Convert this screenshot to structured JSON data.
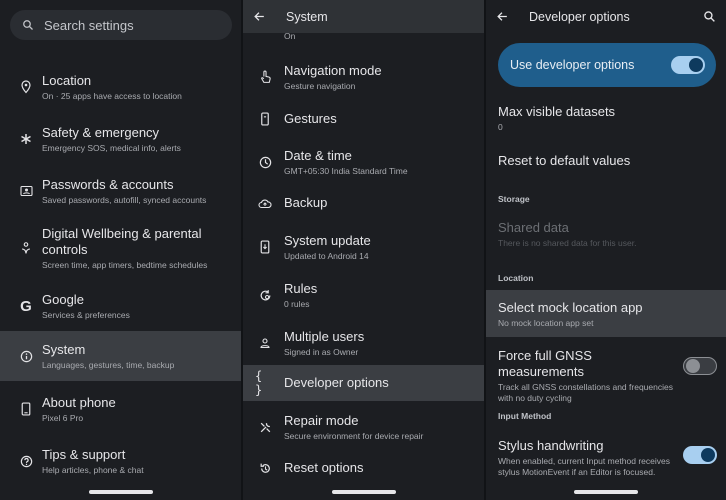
{
  "colors": {
    "background": "#1c1e22",
    "selected": "#3b3e43",
    "accent": "#1f5e8c",
    "toggle_on": "#a8cff0"
  },
  "settings": {
    "search_placeholder": "Search settings",
    "items": [
      {
        "icon": "location-pin-icon",
        "title": "Location",
        "subtitle": "On · 25 apps have access to location"
      },
      {
        "icon": "asterisk-icon",
        "title": "Safety & emergency",
        "subtitle": "Emergency SOS, medical info, alerts"
      },
      {
        "icon": "id-card-icon",
        "title": "Passwords & accounts",
        "subtitle": "Saved passwords, autofill, synced accounts"
      },
      {
        "icon": "wellbeing-icon",
        "title": "Digital Wellbeing & parental controls",
        "subtitle": "Screen time, app timers, bedtime schedules"
      },
      {
        "icon": "google-icon",
        "title": "Google",
        "subtitle": "Services & preferences"
      },
      {
        "icon": "info-icon",
        "title": "System",
        "subtitle": "Languages, gestures, time, backup"
      },
      {
        "icon": "phone-icon",
        "title": "About phone",
        "subtitle": "Pixel 6 Pro"
      },
      {
        "icon": "help-icon",
        "title": "Tips & support",
        "subtitle": "Help articles, phone & chat"
      }
    ]
  },
  "system": {
    "title": "System",
    "cut_text": "On",
    "items": [
      {
        "icon": "navigation-mode-icon",
        "title": "Navigation mode",
        "subtitle": "Gesture navigation"
      },
      {
        "icon": "gestures-icon",
        "title": "Gestures",
        "subtitle": ""
      },
      {
        "icon": "clock-icon",
        "title": "Date & time",
        "subtitle": "GMT+05:30 India Standard Time"
      },
      {
        "icon": "cloud-icon",
        "title": "Backup",
        "subtitle": ""
      },
      {
        "icon": "system-update-icon",
        "title": "System update",
        "subtitle": "Updated to Android 14"
      },
      {
        "icon": "rules-icon",
        "title": "Rules",
        "subtitle": "0 rules"
      },
      {
        "icon": "person-icon",
        "title": "Multiple users",
        "subtitle": "Signed in as Owner"
      },
      {
        "icon": "braces-icon",
        "title": "Developer options",
        "subtitle": ""
      },
      {
        "icon": "wrench-icon",
        "title": "Repair mode",
        "subtitle": "Secure environment for device repair"
      },
      {
        "icon": "reset-icon",
        "title": "Reset options",
        "subtitle": ""
      }
    ]
  },
  "developer": {
    "title": "Developer options",
    "use_label": "Use developer options",
    "use_enabled": true,
    "max_datasets_title": "Max visible datasets",
    "max_datasets_value": "0",
    "reset_defaults": "Reset to default values",
    "storage_header": "Storage",
    "shared_data_title": "Shared data",
    "shared_data_subtitle": "There is no shared data for this user.",
    "location_header": "Location",
    "mock_title": "Select mock location app",
    "mock_subtitle": "No mock location app set",
    "gnss_title": "Force full GNSS measurements",
    "gnss_subtitle": "Track all GNSS constellations and frequencies with no duty cycling",
    "gnss_enabled": false,
    "input_header": "Input Method",
    "stylus_title": "Stylus handwriting",
    "stylus_subtitle": "When enabled, current Input method receives stylus MotionEvent if an Editor is focused.",
    "stylus_enabled": true
  }
}
